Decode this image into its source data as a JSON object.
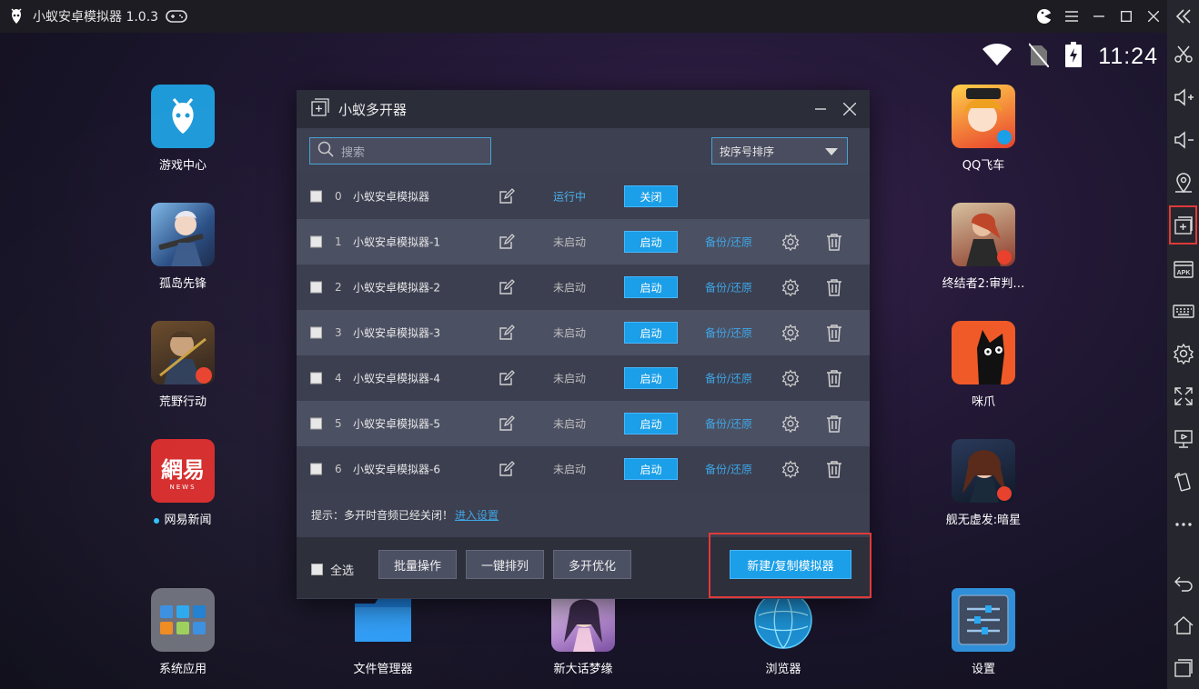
{
  "window": {
    "title": "小蚁安卓模拟器 1.0.3",
    "controls": [
      "theme-icon",
      "menu-icon",
      "minimize-icon",
      "maximize-icon",
      "close-icon",
      "collapse-icon"
    ]
  },
  "statusbar": {
    "time": "11:24"
  },
  "desktop": {
    "apps": [
      {
        "label": "游戏中心"
      },
      {
        "label": "孤岛先锋"
      },
      {
        "label": "荒野行动"
      },
      {
        "label": "网易新闻",
        "new": true
      },
      {
        "label": "系统应用"
      },
      {
        "label": "文件管理器"
      },
      {
        "label": "新大话梦缘"
      },
      {
        "label": "浏览器"
      },
      {
        "label": "设置"
      },
      {
        "label": "QQ飞车"
      },
      {
        "label": "终结者2:审判…"
      },
      {
        "label": "咪爪"
      },
      {
        "label": "舰无虚发:暗星"
      }
    ],
    "netease_icon_text": "網易",
    "netease_icon_sub": "NEWS"
  },
  "dialog": {
    "title": "小蚁多开器",
    "search_placeholder": "搜索",
    "sort_selected": "按序号排序",
    "rows": [
      {
        "idx": "0",
        "name": "小蚁安卓模拟器",
        "status": "运行中",
        "button": "关闭",
        "backup": "",
        "running": true
      },
      {
        "idx": "1",
        "name": "小蚁安卓模拟器-1",
        "status": "未启动",
        "button": "启动",
        "backup": "备份/还原"
      },
      {
        "idx": "2",
        "name": "小蚁安卓模拟器-2",
        "status": "未启动",
        "button": "启动",
        "backup": "备份/还原"
      },
      {
        "idx": "3",
        "name": "小蚁安卓模拟器-3",
        "status": "未启动",
        "button": "启动",
        "backup": "备份/还原"
      },
      {
        "idx": "4",
        "name": "小蚁安卓模拟器-4",
        "status": "未启动",
        "button": "启动",
        "backup": "备份/还原"
      },
      {
        "idx": "5",
        "name": "小蚁安卓模拟器-5",
        "status": "未启动",
        "button": "启动",
        "backup": "备份/还原"
      },
      {
        "idx": "6",
        "name": "小蚁安卓模拟器-6",
        "status": "未启动",
        "button": "启动",
        "backup": "备份/还原"
      }
    ],
    "tip_text": "提示：多开时音频已经关闭！",
    "tip_link": "进入设置",
    "footer": {
      "select_all": "全选",
      "batch": "批量操作",
      "arrange": "一键排列",
      "optimize": "多开优化",
      "new_copy": "新建/复制模拟器"
    }
  },
  "colors": {
    "accent": "#1a9fe8",
    "highlight": "#e03a3a"
  }
}
